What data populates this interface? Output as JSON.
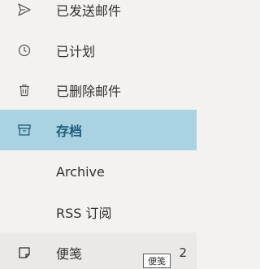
{
  "folders": [
    {
      "label": "已发送邮件",
      "icon": "send-icon"
    },
    {
      "label": "已计划",
      "icon": "clock-icon"
    },
    {
      "label": "已删除邮件",
      "icon": "trash-icon"
    },
    {
      "label": "存档",
      "icon": "archive-icon",
      "selected": true
    },
    {
      "label": "Archive"
    },
    {
      "label": "RSS 订阅"
    },
    {
      "label": "便笺",
      "icon": "note-icon",
      "count": "2"
    }
  ],
  "tooltip": "便笺",
  "colors": {
    "background": "#f3f2f1",
    "selected_background": "#a9d3e2",
    "selected_text": "#1f5b7a"
  }
}
